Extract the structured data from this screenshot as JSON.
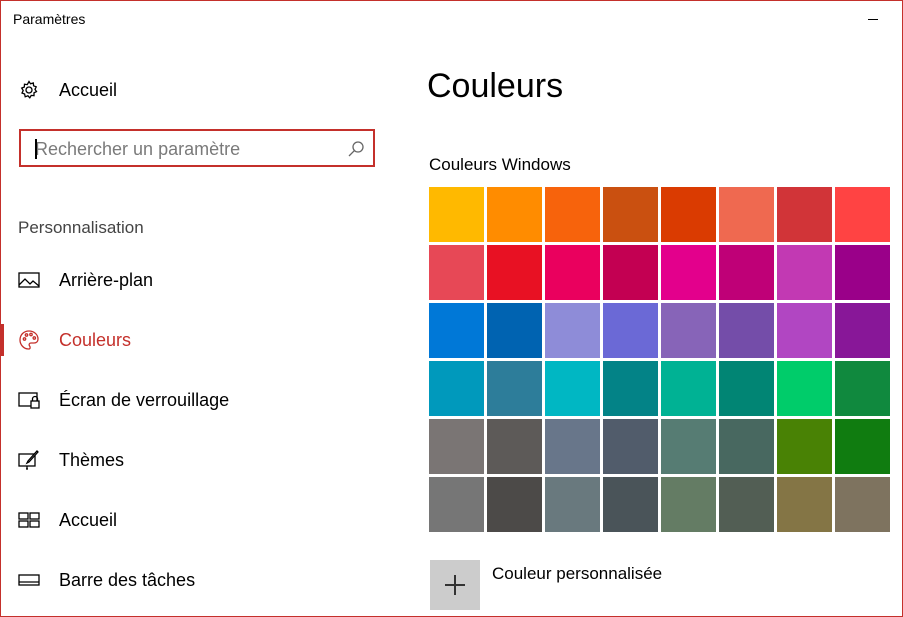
{
  "window": {
    "title": "Paramètres"
  },
  "sidebar": {
    "home_label": "Accueil",
    "search_placeholder": "Rechercher un paramètre",
    "section_label": "Personnalisation",
    "items": [
      {
        "label": "Arrière-plan",
        "icon": "picture-icon"
      },
      {
        "label": "Couleurs",
        "icon": "palette-icon",
        "active": true
      },
      {
        "label": "Écran de verrouillage",
        "icon": "lock-screen-icon"
      },
      {
        "label": "Thèmes",
        "icon": "themes-icon"
      },
      {
        "label": "Accueil",
        "icon": "start-icon"
      },
      {
        "label": "Barre des tâches",
        "icon": "taskbar-icon"
      }
    ]
  },
  "main": {
    "title": "Couleurs",
    "windows_colors_label": "Couleurs Windows",
    "custom_color_label": "Couleur personnalisée",
    "swatches": [
      [
        "#FFB900",
        "#FF8C00",
        "#F7630C",
        "#CA5010",
        "#DA3B01",
        "#EF6950",
        "#D13438",
        "#FF4343"
      ],
      [
        "#E74856",
        "#E81123",
        "#EA005E",
        "#C30052",
        "#E3008C",
        "#BF0077",
        "#C239B3",
        "#9A0089"
      ],
      [
        "#0078D7",
        "#0063B1",
        "#8E8CD8",
        "#6B69D6",
        "#8764B8",
        "#744DA9",
        "#B146C2",
        "#881798"
      ],
      [
        "#0099BC",
        "#2D7D9A",
        "#00B7C3",
        "#038387",
        "#00B294",
        "#018574",
        "#00CC6A",
        "#10893E"
      ],
      [
        "#7A7574",
        "#5D5A58",
        "#68768A",
        "#515C6B",
        "#567C73",
        "#486860",
        "#498205",
        "#107C10"
      ],
      [
        "#767676",
        "#4C4A48",
        "#69797E",
        "#4A5459",
        "#647C64",
        "#525E54",
        "#847545",
        "#7E735F"
      ]
    ]
  },
  "colors": {
    "accent": "#C4302B"
  }
}
